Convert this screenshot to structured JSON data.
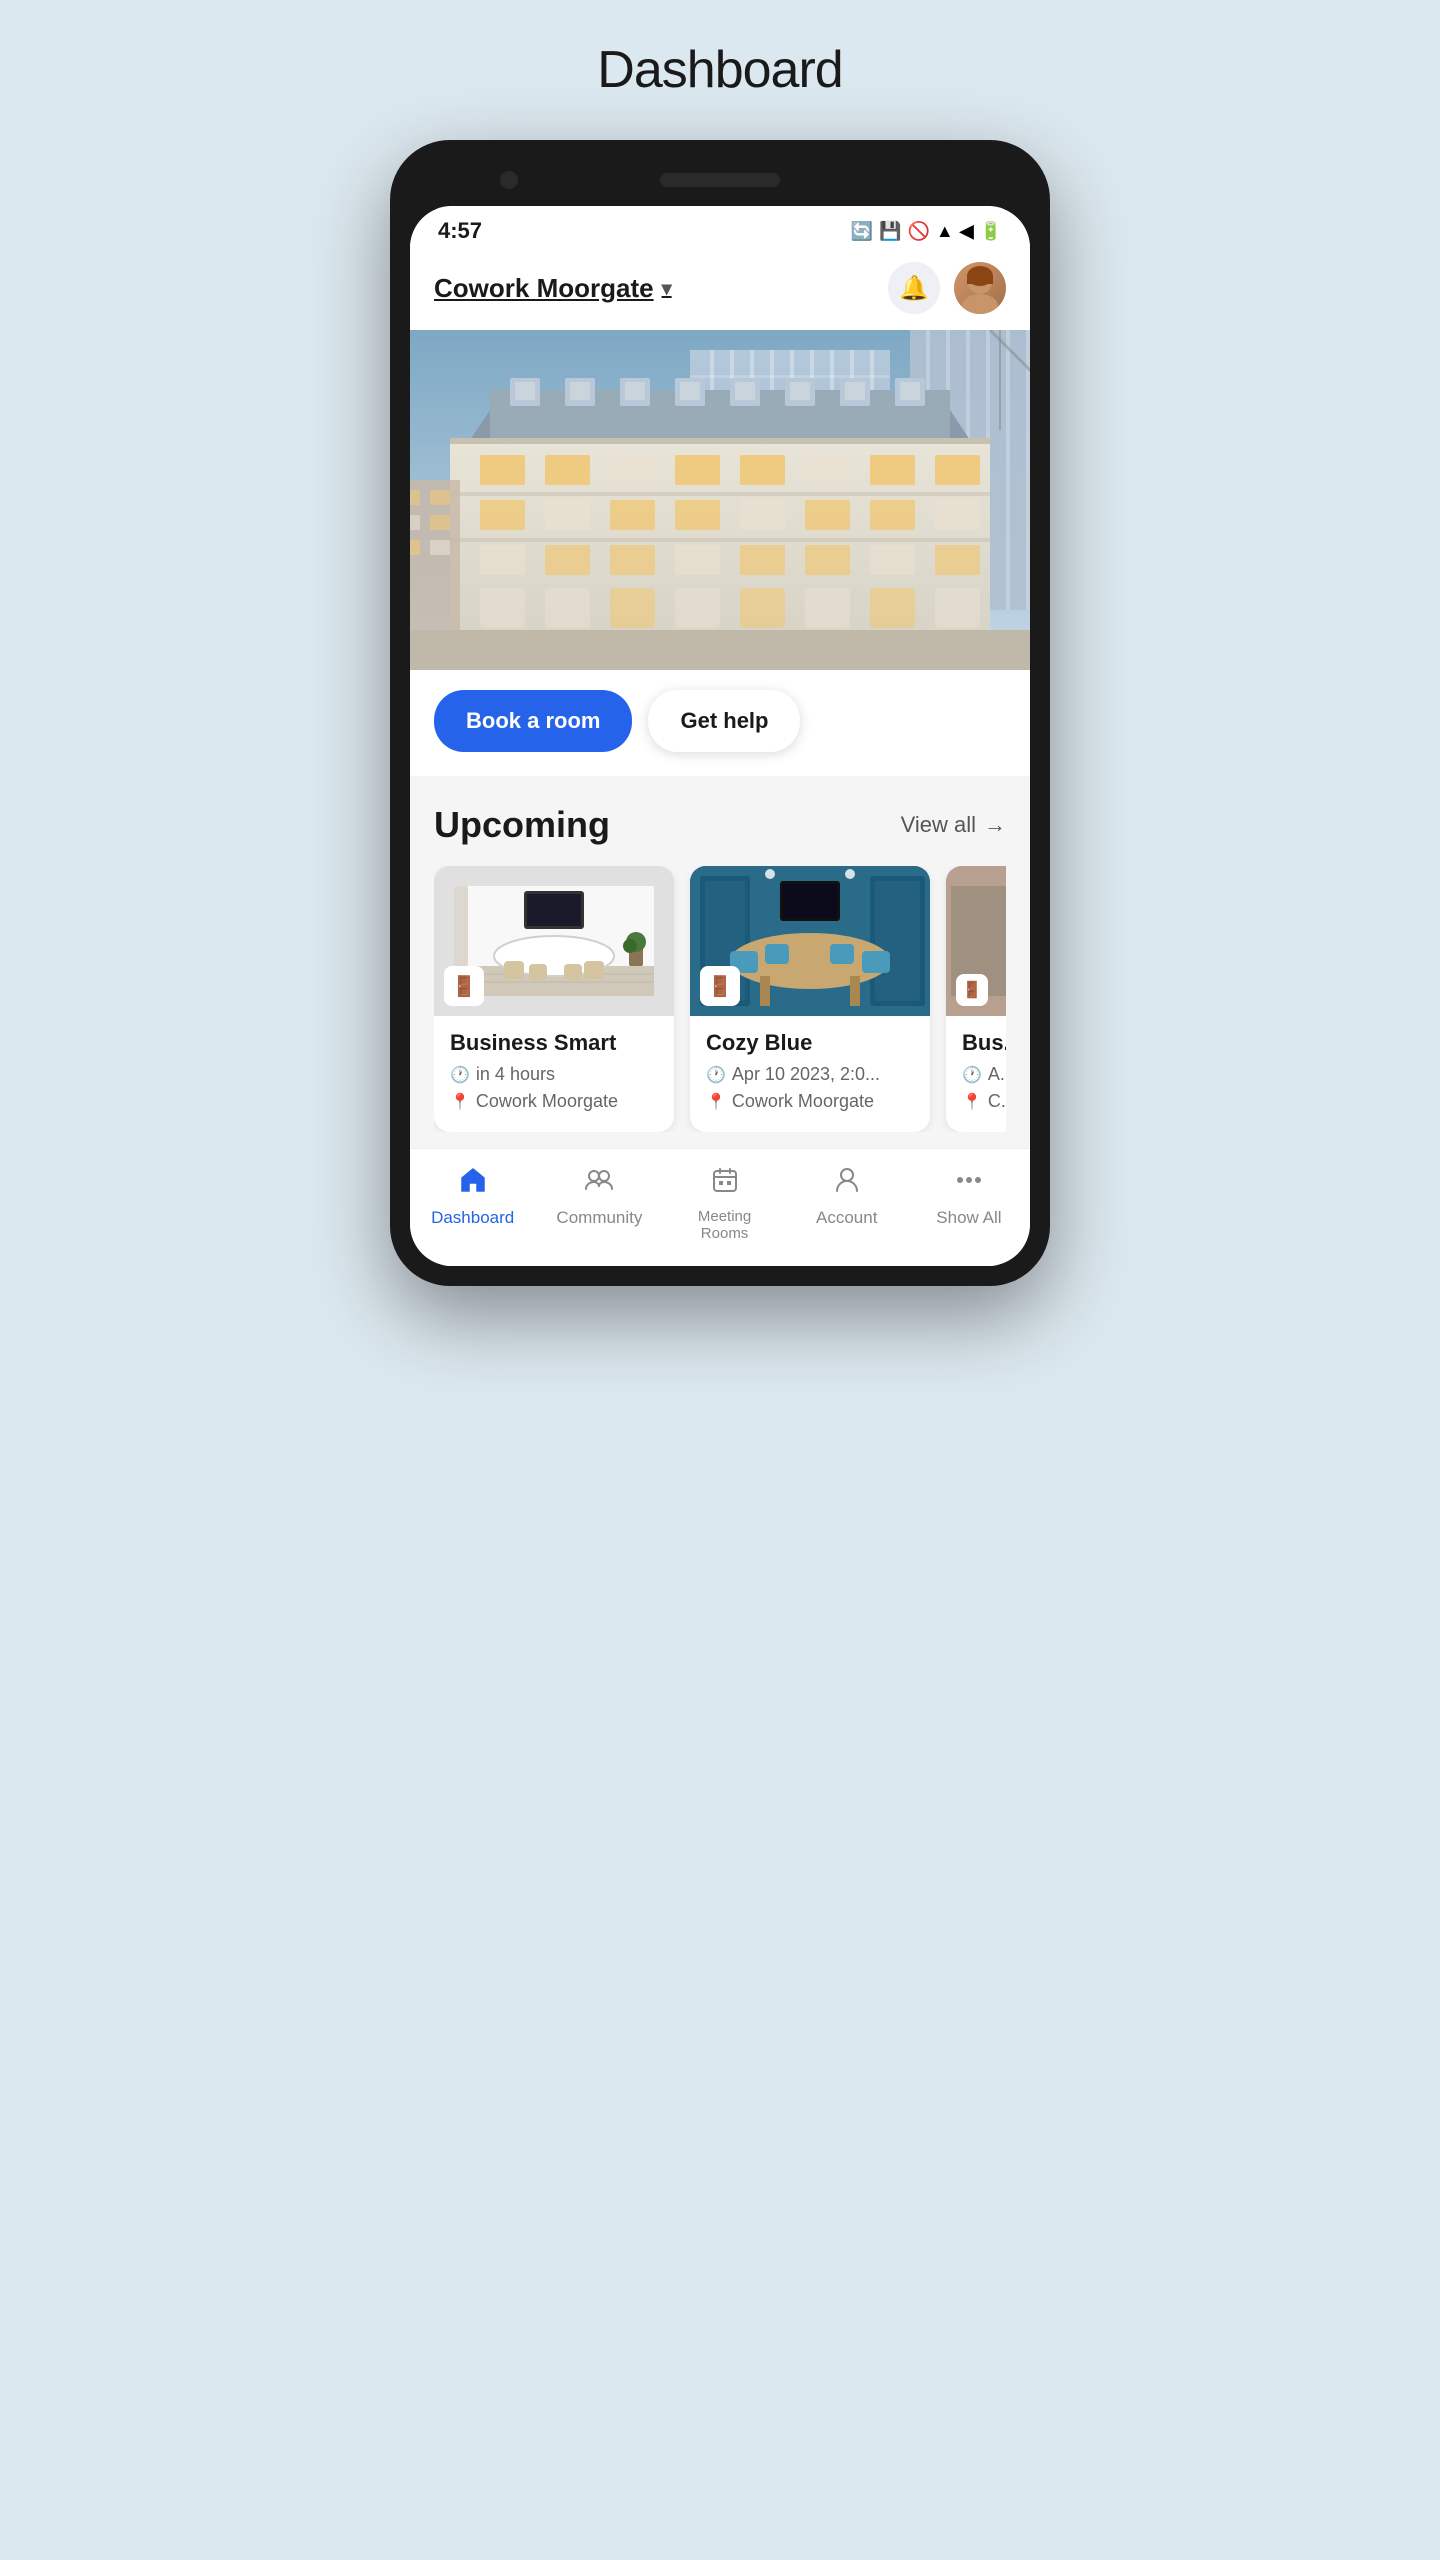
{
  "page": {
    "title": "Dashboard"
  },
  "statusBar": {
    "time": "4:57",
    "wifi": "▲",
    "signal": "◀",
    "battery": "▮"
  },
  "header": {
    "location": "Cowork Moorgate",
    "chevron": "▾",
    "bell_label": "notifications",
    "avatar_initials": "👩"
  },
  "cta": {
    "book_label": "Book a room",
    "help_label": "Get help"
  },
  "upcoming": {
    "title": "Upcoming",
    "view_all": "View all",
    "arrow": "→",
    "cards": [
      {
        "id": 1,
        "name": "Business Smart",
        "time": "in 4 hours",
        "location": "Cowork Moorgate"
      },
      {
        "id": 2,
        "name": "Cozy Blue",
        "time": "Apr 10 2023, 2:0...",
        "location": "Cowork Moorgate"
      },
      {
        "id": 3,
        "name": "Bus...",
        "time": "A...",
        "location": "C..."
      }
    ]
  },
  "bottomNav": {
    "items": [
      {
        "id": "dashboard",
        "label": "Dashboard",
        "icon": "🏠",
        "active": true
      },
      {
        "id": "community",
        "label": "Community",
        "icon": "👥",
        "active": false
      },
      {
        "id": "meeting-rooms",
        "label": "Meeting\nRooms",
        "icon": "📅",
        "active": false
      },
      {
        "id": "account",
        "label": "Account",
        "icon": "👤",
        "active": false
      },
      {
        "id": "show-all",
        "label": "Show All",
        "icon": "···",
        "active": false
      }
    ]
  }
}
